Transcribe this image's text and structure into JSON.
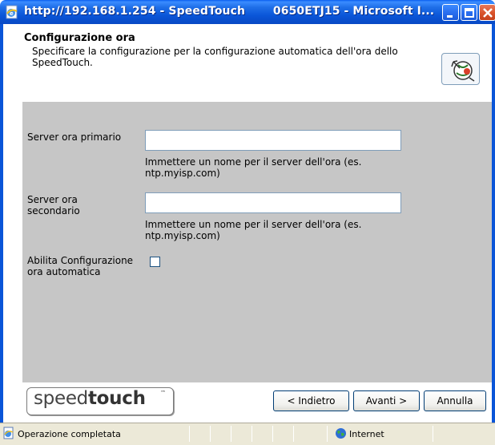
{
  "window": {
    "title": "http://192.168.1.254 - SpeedTouch       0650ETJ15 - Microsoft I..."
  },
  "header": {
    "title": "Configurazione ora",
    "description": "Specificare la configurazione per la configurazione automatica dell'ora dello SpeedTouch.",
    "icon": "clock-globe-icon"
  },
  "form": {
    "primary_server": {
      "label": "Server ora primario",
      "value": "",
      "hint": "Immettere un nome per il server dell'ora (es. ntp.myisp.com)"
    },
    "secondary_server": {
      "label": "Server ora secondario",
      "value": "",
      "hint": "Immettere un nome per il server dell'ora (es. ntp.myisp.com)"
    },
    "auto_config": {
      "label": "Abilita Configurazione ora automatica",
      "checked": false
    }
  },
  "footer": {
    "brand_light": "speed",
    "brand_bold": "touch",
    "brand_tm": "™",
    "back_label": "< Indietro",
    "next_label": "Avanti >",
    "cancel_label": "Annulla"
  },
  "statusbar": {
    "status_text": "Operazione completata",
    "zone_text": "Internet"
  },
  "colors": {
    "titlebar": "#0a55d8",
    "content_bg": "#c6c6c6",
    "statusbar_bg": "#ece9d8"
  }
}
